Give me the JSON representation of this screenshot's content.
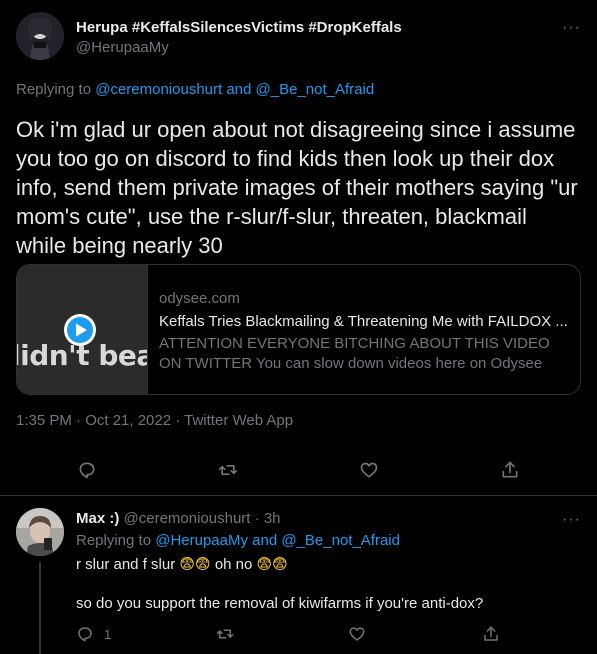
{
  "main_tweet": {
    "author_name": "Herupa #KeffalsSilencesVictims #DropKeffals",
    "handle": "@HerupaaMy",
    "replying_prefix": "Replying to",
    "replying_users": "@ceremonioushurt and @_Be_not_Afraid",
    "body": "Ok i'm glad ur open about not disagreeing since i assume you too go on discord to find kids then look up their dox info, send them private images of their mothers saying \"ur mom's cute\", use the r-slur/f-slur, threaten, blackmail while being nearly 30",
    "link_card": {
      "domain": "odysee.com",
      "title": "Keffals Tries Blackmailing & Threatening Me with FAILDOX ...",
      "description": "ATTENTION EVERYONE BITCHING ABOUT THIS VIDEO ON TWITTER You can slow down videos here on Odysee and ...",
      "thumb_text": "lidn't beat"
    },
    "timestamp": "1:35 PM · Oct 21, 2022 · Twitter Web App"
  },
  "reply_tweet": {
    "author_name": "Max :)",
    "handle": "@ceremonioushurt",
    "separator": "·",
    "time": "3h",
    "replying_prefix": "Replying to",
    "replying_users": "@HerupaaMy and @_Be_not_Afraid",
    "line1_text": "r slur and f slur",
    "line1_emoji": "😨😨",
    "line1_text2": "oh no",
    "line1_emoji2": "😨😨",
    "line2": "so do you support the removal of kiwifarms if you're anti-dox?",
    "reply_count": "1"
  },
  "more_label": "···",
  "colors": {
    "background": "#000000",
    "text": "#e7e9ea",
    "muted": "#71767b",
    "link": "#1d9bf0",
    "border": "#2f3336"
  }
}
